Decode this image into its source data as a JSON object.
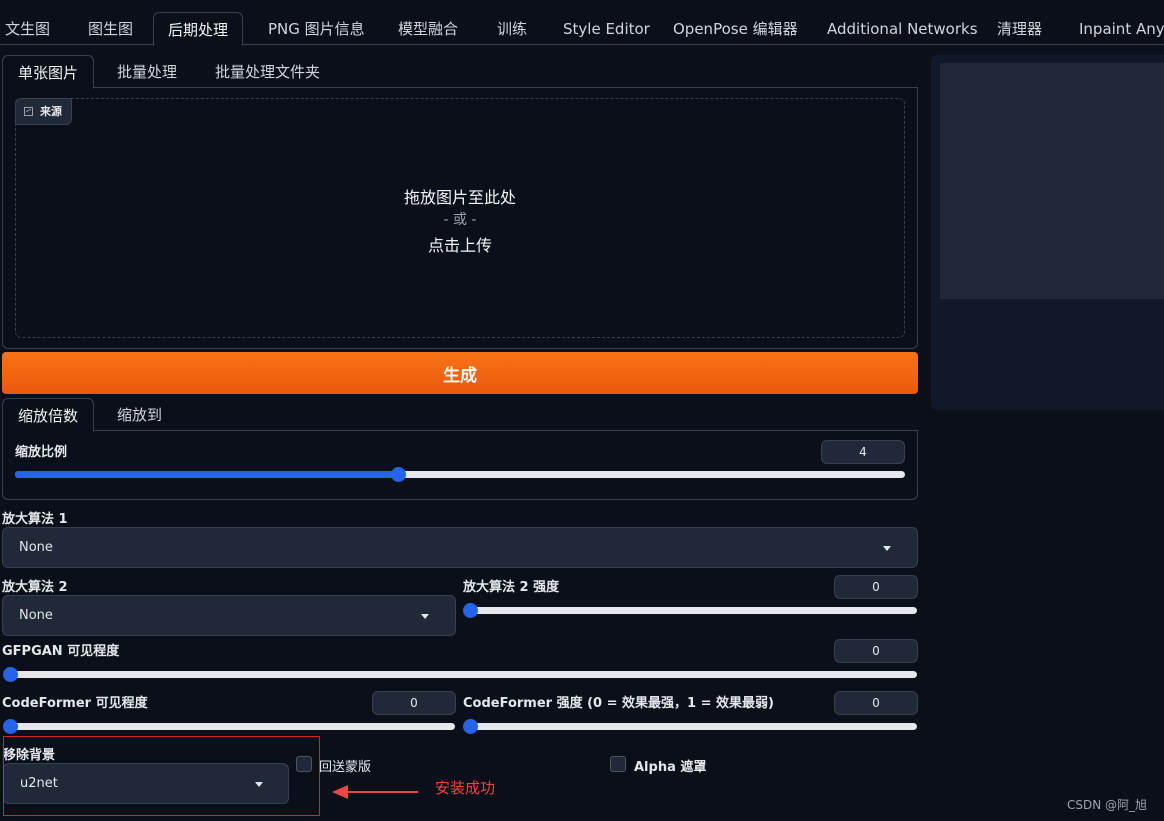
{
  "top_tabs": [
    "文生图",
    "图生图",
    "后期处理",
    "PNG 图片信息",
    "模型融合",
    "训练",
    "Style Editor",
    "OpenPose 编辑器",
    "Additional Networks",
    "清理器",
    "Inpaint Anyth"
  ],
  "active_top_tab": "后期处理",
  "sub_tabs": [
    "单张图片",
    "批量处理",
    "批量处理文件夹"
  ],
  "active_sub_tab": "单张图片",
  "upload": {
    "source_label": "来源",
    "drop_text": "拖放图片至此处",
    "or_text": "- 或 -",
    "click_text": "点击上传"
  },
  "generate_button": "生成",
  "scale_tabs": [
    "缩放倍数",
    "缩放到"
  ],
  "active_scale_tab": "缩放倍数",
  "resize": {
    "label": "缩放比例",
    "value": "4",
    "level": 0.43
  },
  "upscaler1": {
    "label": "放大算法 1",
    "value": "None"
  },
  "upscaler2": {
    "label": "放大算法 2",
    "value": "None"
  },
  "upscaler2_strength": {
    "label": "放大算法 2 强度",
    "value": "0",
    "level": 0
  },
  "gfpgan": {
    "label": "GFPGAN 可见程度",
    "value": "0",
    "level": 0
  },
  "codeformer_visibility": {
    "label": "CodeFormer 可见程度",
    "value": "0",
    "level": 0
  },
  "codeformer_weight": {
    "label": "CodeFormer 强度 (0 = 效果最强，1 = 效果最弱)",
    "value": "0",
    "level": 0
  },
  "remove_bg": {
    "label": "移除背景",
    "value": "u2net"
  },
  "return_mask": {
    "label": "回送蒙版",
    "checked": false
  },
  "alpha_matting": {
    "label": "Alpha 遮罩",
    "checked": false
  },
  "annotation": "安装成功",
  "watermark": "CSDN @阿_旭",
  "colors": {
    "accent": "#2563eb",
    "generate": "#f97316",
    "annotation": "#ef4444",
    "background": "#0b0f19"
  }
}
